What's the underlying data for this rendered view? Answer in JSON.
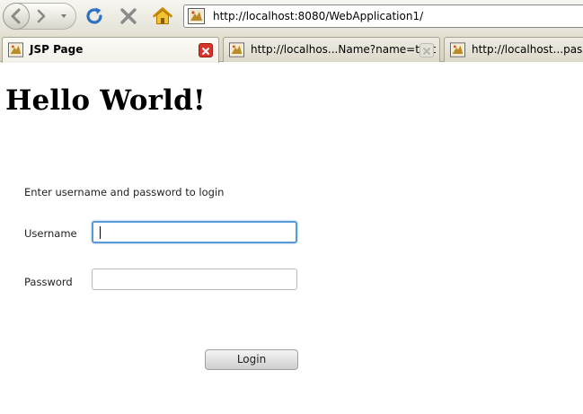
{
  "browser": {
    "url": "http://localhost:8080/WebApplication1/",
    "tabs": [
      {
        "label": "JSP Page",
        "active": true
      },
      {
        "label": "http://localhos...Name?name=test",
        "active": false
      },
      {
        "label": "http://localhost...password=test",
        "active": false
      }
    ]
  },
  "page": {
    "title": "Hello World!",
    "instructions": "Enter username and password to login",
    "username_label": "Username",
    "username_value": "",
    "password_label": "Password",
    "password_value": "",
    "login_label": "Login"
  },
  "icons": {
    "back": "back-arrow-icon",
    "forward": "forward-arrow-icon",
    "reload": "reload-icon",
    "stop": "stop-icon",
    "home": "home-icon",
    "favicon": "page-favicon-icon",
    "close": "close-icon"
  },
  "colors": {
    "reload": "#2f6fc4",
    "stop": "#8a8a8a",
    "home": "#e0a000",
    "tab_close": "#d8352a",
    "focus_border": "#5a9ad6"
  }
}
